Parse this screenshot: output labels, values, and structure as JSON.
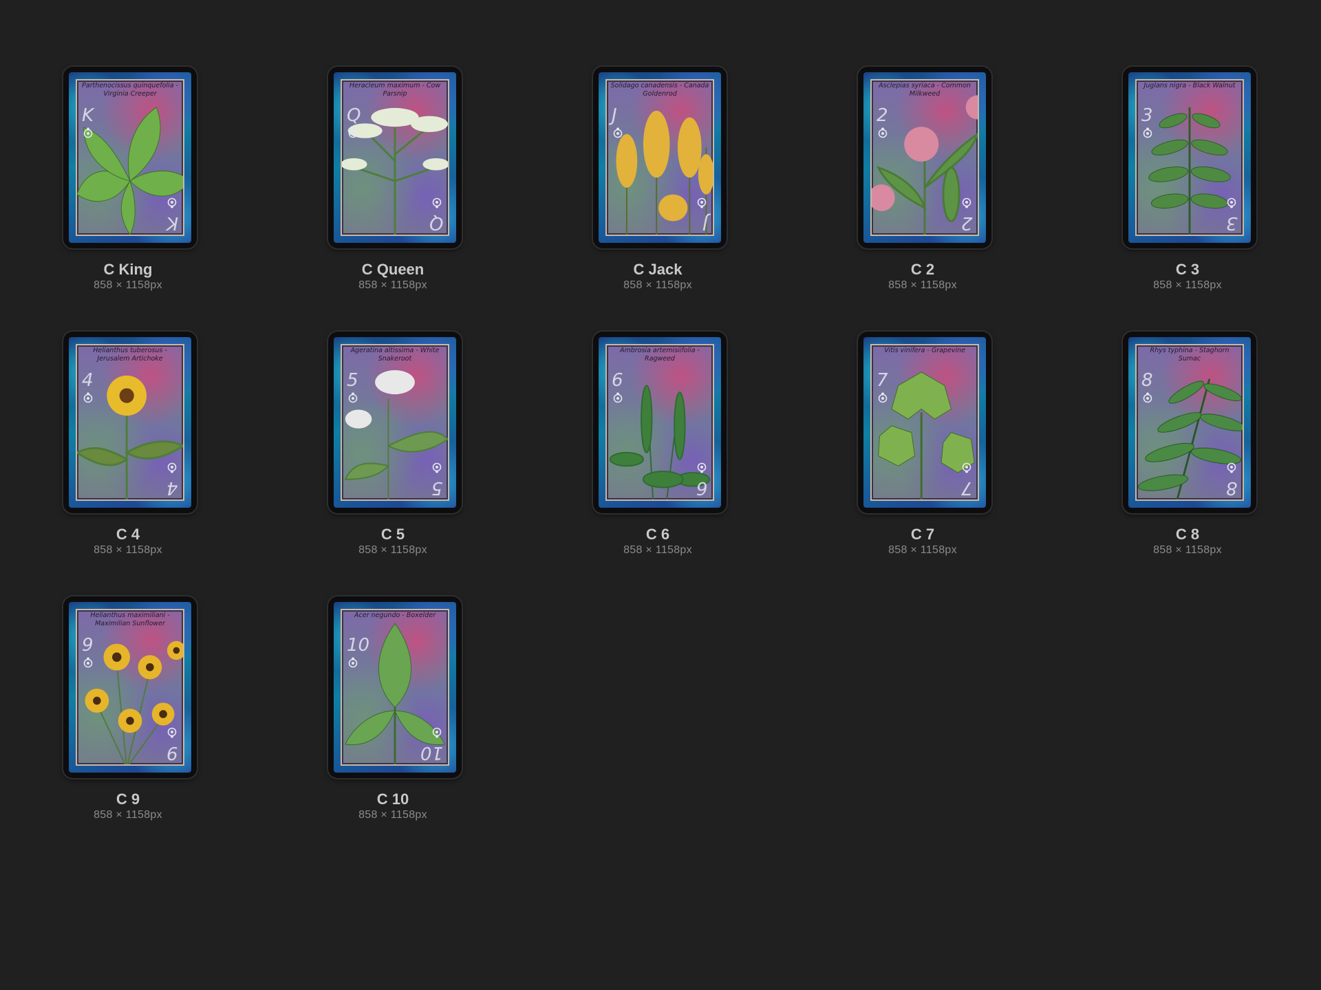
{
  "files": [
    {
      "title": "C King",
      "size": "858 × 1158px",
      "caption": "Parthenocissus quinquefolia - Virginia Creeper",
      "rank": "K",
      "plant": "leaf-cluster-icon"
    },
    {
      "title": "C Queen",
      "size": "858 × 1158px",
      "caption": "Heracleum maximum - Cow Parsnip",
      "rank": "Q",
      "plant": "umbel-flower-icon"
    },
    {
      "title": "C Jack",
      "size": "858 × 1158px",
      "caption": "Solidago canadensis - Canada Goldenrod",
      "rank": "J",
      "plant": "goldenrod-icon"
    },
    {
      "title": "C 2",
      "size": "858 × 1158px",
      "caption": "Asclepias syriaca - Common Milkweed",
      "rank": "2",
      "plant": "milkweed-icon"
    },
    {
      "title": "C 3",
      "size": "858 × 1158px",
      "caption": "Juglans nigra - Black Walnut",
      "rank": "3",
      "plant": "compound-leaf-icon"
    },
    {
      "title": "C 4",
      "size": "858 × 1158px",
      "caption": "Helianthus tuberosus - Jerusalem Artichoke",
      "rank": "4",
      "plant": "sunflower-icon"
    },
    {
      "title": "C 5",
      "size": "858 × 1158px",
      "caption": "Ageratina altissima - White Snakeroot",
      "rank": "5",
      "plant": "white-cluster-icon"
    },
    {
      "title": "C 6",
      "size": "858 × 1158px",
      "caption": "Ambrosia artemisiifolia - Ragweed",
      "rank": "6",
      "plant": "ragweed-icon"
    },
    {
      "title": "C 7",
      "size": "858 × 1158px",
      "caption": "Vitis vinifera - Grapevine",
      "rank": "7",
      "plant": "grape-leaf-icon"
    },
    {
      "title": "C 8",
      "size": "858 × 1158px",
      "caption": "Rhys typhina - Staghorn Sumac",
      "rank": "8",
      "plant": "sumac-leaf-icon"
    },
    {
      "title": "C 9",
      "size": "858 × 1158px",
      "caption": "Helianthus maximiliani - Maximilian Sunflower",
      "rank": "9",
      "plant": "sunflower-cluster-icon"
    },
    {
      "title": "C 10",
      "size": "858 × 1158px",
      "caption": "Acer negundo - Boxelder",
      "rank": "10",
      "plant": "boxelder-leaf-icon"
    }
  ]
}
